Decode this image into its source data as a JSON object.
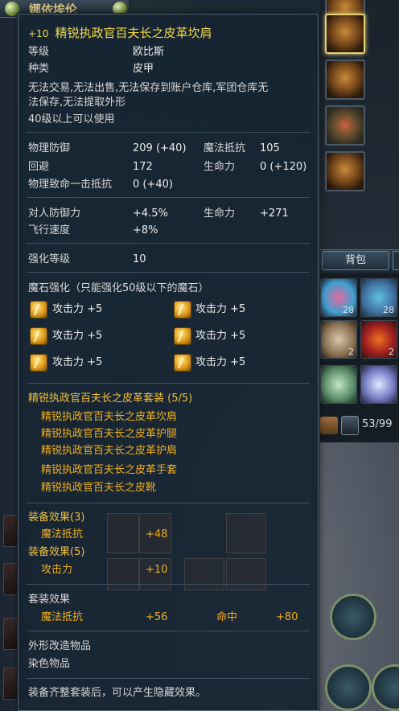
{
  "background": {
    "window_title": "娜依埃伦",
    "inventory_tab": "背包",
    "inventory_counts": [
      "28",
      "28",
      "2",
      "2"
    ],
    "inventory_capacity": "53/99"
  },
  "tooltip": {
    "enchant": "+10",
    "item_name": "精锐执政官百夫长之皮革坎肩",
    "level_label": "等级",
    "level_value": "欧比斯",
    "type_label": "种类",
    "type_value": "皮甲",
    "restrictions_line1": "无法交易,无法出售,无法保存到账户仓库,军团仓库无",
    "restrictions_line2": "法保存,无法提取外形",
    "level_req": "40级以上可以使用",
    "stats": [
      {
        "label": "物理防御",
        "value": "209 (+40)"
      },
      {
        "label": "回避",
        "value": "172"
      },
      {
        "label": "物理致命一击抵抗",
        "value": "0 (+40)"
      }
    ],
    "stats_right": [
      {
        "label": "魔法抵抗",
        "value": "105"
      },
      {
        "label": "生命力",
        "value": "0 (+120)"
      }
    ],
    "bonus": [
      {
        "label": "对人防御力",
        "value": "+4.5%"
      },
      {
        "label": "飞行速度",
        "value": "+8%"
      }
    ],
    "bonus_right": {
      "label": "生命力",
      "value": "+271"
    },
    "enhance_label": "强化等级",
    "enhance_value": "10",
    "manastone_header": "魔石强化（只能强化50级以下的魔石）",
    "manastones": [
      "攻击力 +5",
      "攻击力 +5",
      "攻击力 +5",
      "攻击力 +5",
      "攻击力 +5",
      "攻击力 +5"
    ],
    "set_header": "精锐执政官百夫长之皮革套装 (5/5)",
    "set_items": [
      "精锐执政官百夫长之皮革坎肩",
      "精锐执政官百夫长之皮革护腿",
      "精锐执政官百夫长之皮革护肩",
      "精锐执政官百夫长之皮革手套",
      "精锐执政官百夫长之皮靴"
    ],
    "effect3_header": "装备效果(3)",
    "effect3": {
      "label": "魔法抵抗",
      "value": "+48"
    },
    "effect5_header": "装备效果(5)",
    "effect5": {
      "label": "攻击力",
      "value": "+10"
    },
    "full_header": "套装效果",
    "full_effect1": {
      "label": "魔法抵抗",
      "value": "+56"
    },
    "full_effect2": {
      "label": "命中",
      "value": "+80"
    },
    "extra1": "外形改造物品",
    "extra2": "染色物品",
    "footer": "装备齐整套装后，可以产生隐藏效果。"
  },
  "colors": {
    "title": "#f0d848",
    "highlight": "#f0b020",
    "tooltip_bg": "#162432"
  }
}
